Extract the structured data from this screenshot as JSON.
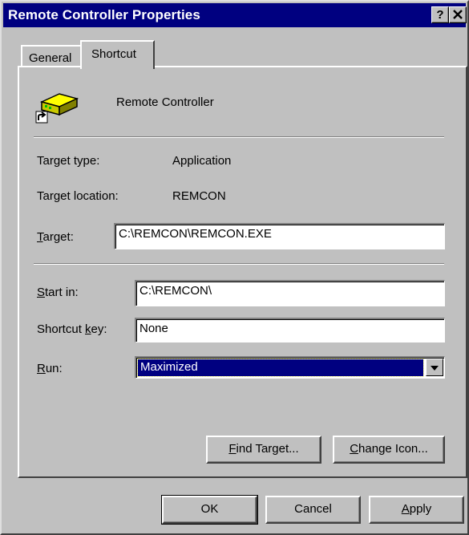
{
  "window": {
    "title": "Remote Controller Properties",
    "help_label": "?",
    "close_label": "x"
  },
  "tabs": {
    "general": "General",
    "shortcut": "Shortcut"
  },
  "shortcut": {
    "name": "Remote Controller",
    "target_type_label": "Target type:",
    "target_type_value": "Application",
    "target_location_label": "Target location:",
    "target_location_value": "REMCON",
    "target_label_first": "T",
    "target_label_rest": "arget:",
    "target_value": "C:\\REMCON\\REMCON.EXE",
    "start_in_label_first": "S",
    "start_in_label_rest": "tart in:",
    "start_in_value": "C:\\REMCON\\",
    "shortcut_key_label_a": "Shortcut ",
    "shortcut_key_label_u": "k",
    "shortcut_key_label_b": "ey:",
    "shortcut_key_value": "None",
    "run_label_first": "R",
    "run_label_rest": "un:",
    "run_value": "Maximized",
    "find_target_first": "F",
    "find_target_rest": "ind Target...",
    "change_icon_first": "C",
    "change_icon_rest": "hange Icon..."
  },
  "footer": {
    "ok": "OK",
    "cancel": "Cancel",
    "apply_first": "A",
    "apply_rest": "pply"
  },
  "colors": {
    "titlebar": "#000080",
    "face": "#c0c0c0",
    "selection": "#000080"
  },
  "icons": {
    "app": "remote-controller-icon",
    "shortcut_overlay": "shortcut-arrow-icon"
  }
}
